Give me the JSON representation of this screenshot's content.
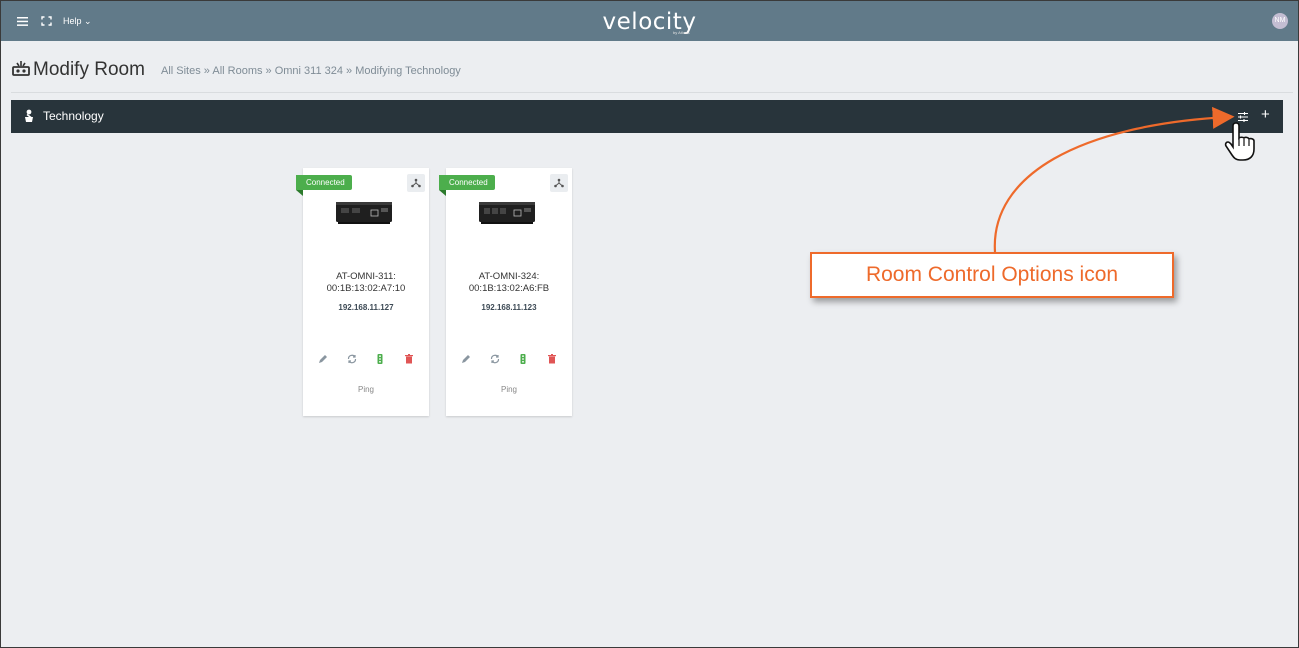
{
  "topbar": {
    "help_label": "Help",
    "logo_text": "velocity",
    "logo_sub": "by Atlona",
    "avatar_initials": "NM"
  },
  "page": {
    "title": "Modify Room",
    "breadcrumb": "All Sites » All Rooms » Omni 311 324 » Modifying Technology"
  },
  "technology": {
    "title": "Technology",
    "add_label": "+"
  },
  "devices": [
    {
      "status": "Connected",
      "name_line1": "AT-OMNI-311:",
      "name_line2": "00:1B:13:02:A7:10",
      "ip": "192.168.11.127",
      "ping_label": "Ping"
    },
    {
      "status": "Connected",
      "name_line1": "AT-OMNI-324:",
      "name_line2": "00:1B:13:02:A6:FB",
      "ip": "192.168.11.123",
      "ping_label": "Ping"
    }
  ],
  "annotation": {
    "callout_text": "Room Control Options icon",
    "accent_color": "#ee6a2b"
  },
  "colors": {
    "topbar": "#617a89",
    "techbar": "#28343b",
    "status_connected": "#4cae4c",
    "delete": "#e05555",
    "green_action": "#4cae4c"
  },
  "icons": {
    "menu": "menu-icon",
    "fullscreen": "fullscreen-icon",
    "room": "room-icon",
    "technology": "technology-icon",
    "room_control_options": "sliders-icon",
    "network": "network-icon",
    "edit": "pencil-icon",
    "refresh": "refresh-icon",
    "traffic": "traffic-light-icon",
    "delete": "trash-icon"
  }
}
